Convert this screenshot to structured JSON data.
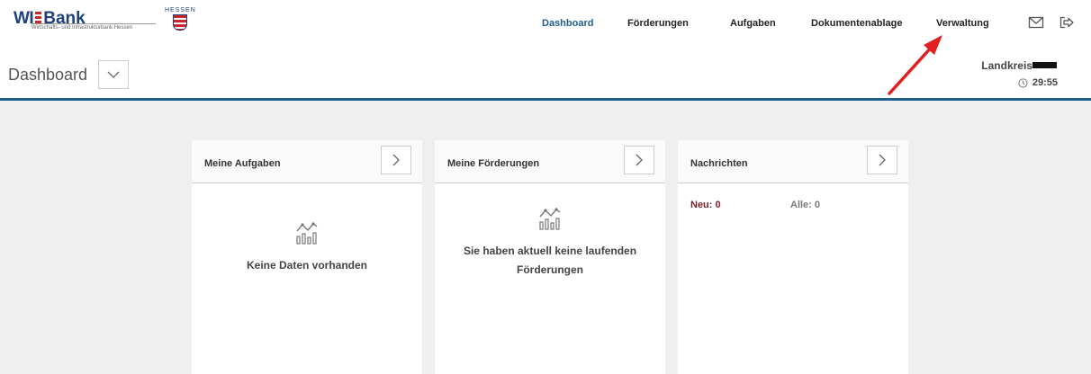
{
  "logo": {
    "wi": "WI",
    "bank": "Bank",
    "subtitle": "Wirtschafts- und Infrastrukturbank Hessen",
    "state": "HESSEN"
  },
  "nav": {
    "dashboard": "Dashboard",
    "foerderungen": "Förderungen",
    "aufgaben": "Aufgaben",
    "dokumente": "Dokumentenablage",
    "verwaltung": "Verwaltung"
  },
  "icons": {
    "mail": "envelope-icon",
    "logout": "logout-icon"
  },
  "page": {
    "title": "Dashboard"
  },
  "session": {
    "user": "Landkreis",
    "timer": "29:55"
  },
  "cards": {
    "aufgaben": {
      "title": "Meine Aufgaben",
      "empty": "Keine Daten vorhanden"
    },
    "foerderungen": {
      "title": "Meine Förderungen",
      "empty_line1": "Sie haben aktuell keine laufenden",
      "empty_line2": "Förderungen"
    },
    "nachrichten": {
      "title": "Nachrichten",
      "new_label": "Neu: 0",
      "all_label": "Alle: 0"
    }
  },
  "colors": {
    "accent": "#1e5f8c",
    "brand": "#1f3f78",
    "alert": "#7a1f2b",
    "annotation": "#e02020"
  }
}
